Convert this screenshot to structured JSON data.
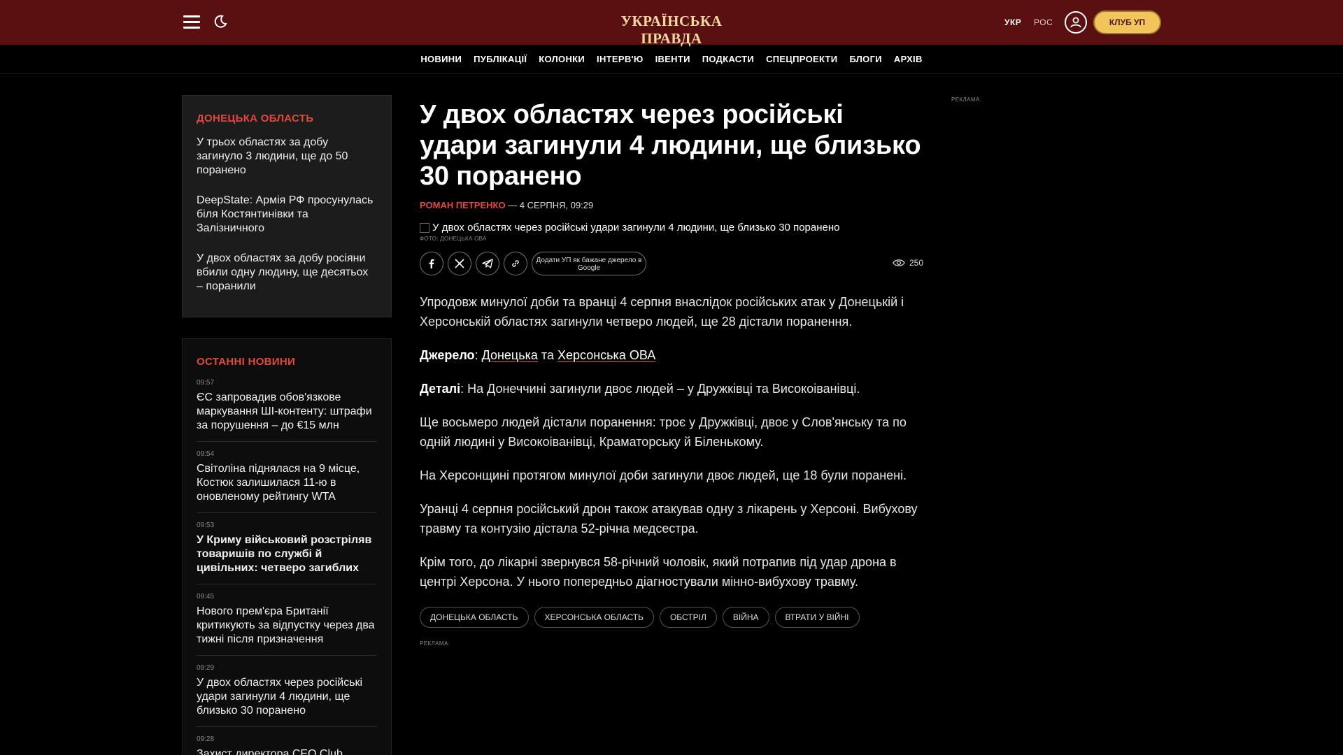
{
  "header": {
    "logo": "УКРАЇНСЬКА ПРАВДА",
    "lang_ukr": "УКР",
    "lang_ros": "РОС",
    "club_button": "КЛУБ УП"
  },
  "nav": [
    "НОВИНИ",
    "ПУБЛІКАЦІЇ",
    "КОЛОНКИ",
    "ІНТЕРВ'Ю",
    "ІВЕНТИ",
    "ПОДКАСТИ",
    "СПЕЦПРОЕКТИ",
    "БЛОГИ",
    "АРХІВ"
  ],
  "sidebar_region": {
    "title": "ДОНЕЦЬКА ОБЛАСТЬ",
    "items": [
      "У трьох областях за добу загинуло 3 людини, ще до 50 поранено",
      "DeepState: Армія РФ просунулась біля Костянтинівки та Залізничного",
      "У двох областях за добу росіяни вбили одну людину, ще десятьох – поранили"
    ]
  },
  "latest_news": {
    "title": "ОСТАННІ НОВИНИ",
    "items": [
      {
        "time": "09:57",
        "text": "ЄС запровадив обов'язкове маркування ШІ-контенту: штрафи за порушення – до €15 млн",
        "bold": false
      },
      {
        "time": "09:54",
        "text": "Світоліна піднялася на 9 місце, Костюк залишилася 11-ю в оновленому рейтингу WTA",
        "bold": false
      },
      {
        "time": "09:53",
        "text": "У Криму військовий розстріляв товаришів по службі й цивільних: четверо загиблих",
        "bold": true
      },
      {
        "time": "09:45",
        "text": "Нового прем'єра Британії критикують за відпустку через два тижні після призначення",
        "bold": false
      },
      {
        "time": "09:29",
        "text": "У двох областях через російські удари загинули 4 людини, ще близько 30 поранено",
        "bold": false
      },
      {
        "time": "09:28",
        "text": "Захист директора CEO Club",
        "bold": false
      }
    ]
  },
  "article": {
    "title": "У двох областях через російські удари загинули 4 людини, ще близько 30 поранено",
    "author": "РОМАН ПЕТРЕНКО",
    "date": "— 4 СЕРПНЯ, 09:29",
    "image_alt": "У двох областях через російські удари загинули 4 людини, ще близько 30 поранено",
    "photo_caption": "ФОТО: ДОНЕЦЬКА ОВА",
    "google_button": "Додати УП як бажане джерело в Google",
    "views": "250",
    "p1": "Упродовж минулої доби та вранці 4 серпня внаслідок російських атак у Донецькій і Херсонській областях загинули четверо людей, ще 28 дістали поранення.",
    "source_label": "Джерело",
    "source_link1": "Донецька",
    "source_and": "та",
    "source_link2": "Херсонська ОВА",
    "details_label": "Деталі",
    "details_text": ": На Донеччині загинули двоє людей – у Дружківці та Високоіванівці.",
    "p3": "Ще восьмеро людей дістали поранення: троє у Дружківці, двоє у Слов'янську та по одній людині у Високоіванівці, Краматорську й Біленькому.",
    "p4": "На Херсонщині протягом минулої доби загинули двоє людей, ще 18 були поранені.",
    "p5": "Уранці 4 серпня російський дрон також атакував одну з лікарень у Херсоні. Вибухову травму та контузію дістала 52-річна медсестра.",
    "p6": "Крім того, до лікарні звернувся 58-річний чоловік, який потрапив під удар дрона в центрі Херсона. У нього попередньо діагностували мінно-вибухову травму.",
    "tags": [
      "ДОНЕЦЬКА ОБЛАСТЬ",
      "ХЕРСОНСЬКА ОБЛАСТЬ",
      "ОБСТРІЛ",
      "ВІЙНА",
      "ВТРАТИ У ВІЙНІ"
    ]
  },
  "ad_label": "РЕКЛАМА:",
  "colors": {
    "header_bg": "#5a0f10",
    "accent": "#e04a3c",
    "club": "#f3c45a",
    "logo": "#f0d9a0"
  }
}
